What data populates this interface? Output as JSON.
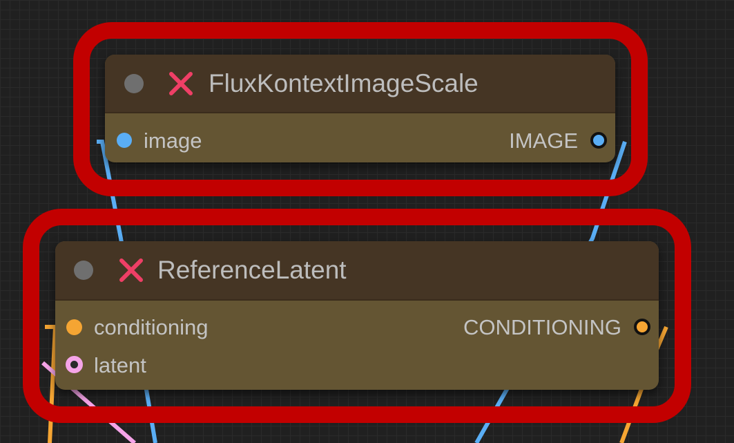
{
  "nodes": [
    {
      "title": "FluxKontextImageScale",
      "inputs": [
        {
          "label": "image",
          "color": "#5aaef5"
        }
      ],
      "outputs": [
        {
          "label": "IMAGE",
          "color": "#5aaef5"
        }
      ]
    },
    {
      "title": "ReferenceLatent",
      "inputs": [
        {
          "label": "conditioning",
          "color": "#f5a533"
        },
        {
          "label": "latent",
          "color": "#f5a4e8"
        }
      ],
      "outputs": [
        {
          "label": "CONDITIONING",
          "color": "#f5a533"
        }
      ]
    }
  ],
  "colors": {
    "highlight": "#c20000",
    "node_body": "#645533",
    "node_header": "#453524",
    "image_link": "#5aaef5",
    "conditioning_link": "#f5a533",
    "latent_link": "#f5a4e8"
  },
  "icons": {
    "bypass": "x-icon",
    "collapse": "collapse-dot-icon"
  }
}
